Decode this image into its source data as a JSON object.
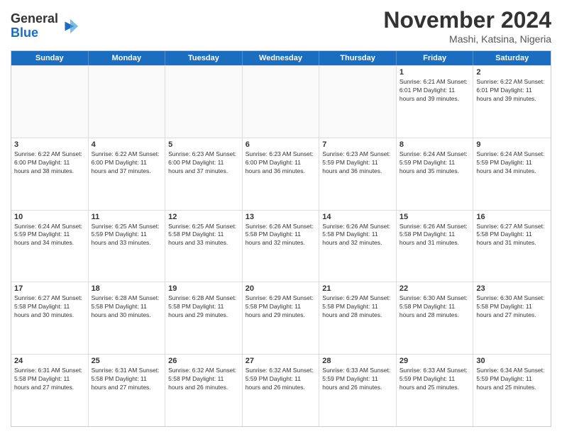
{
  "logo": {
    "general": "General",
    "blue": "Blue"
  },
  "title": "November 2024",
  "location": "Mashi, Katsina, Nigeria",
  "header_days": [
    "Sunday",
    "Monday",
    "Tuesday",
    "Wednesday",
    "Thursday",
    "Friday",
    "Saturday"
  ],
  "weeks": [
    [
      {
        "day": "",
        "info": ""
      },
      {
        "day": "",
        "info": ""
      },
      {
        "day": "",
        "info": ""
      },
      {
        "day": "",
        "info": ""
      },
      {
        "day": "",
        "info": ""
      },
      {
        "day": "1",
        "info": "Sunrise: 6:21 AM\nSunset: 6:01 PM\nDaylight: 11 hours and 39 minutes."
      },
      {
        "day": "2",
        "info": "Sunrise: 6:22 AM\nSunset: 6:01 PM\nDaylight: 11 hours and 39 minutes."
      }
    ],
    [
      {
        "day": "3",
        "info": "Sunrise: 6:22 AM\nSunset: 6:00 PM\nDaylight: 11 hours and 38 minutes."
      },
      {
        "day": "4",
        "info": "Sunrise: 6:22 AM\nSunset: 6:00 PM\nDaylight: 11 hours and 37 minutes."
      },
      {
        "day": "5",
        "info": "Sunrise: 6:23 AM\nSunset: 6:00 PM\nDaylight: 11 hours and 37 minutes."
      },
      {
        "day": "6",
        "info": "Sunrise: 6:23 AM\nSunset: 6:00 PM\nDaylight: 11 hours and 36 minutes."
      },
      {
        "day": "7",
        "info": "Sunrise: 6:23 AM\nSunset: 5:59 PM\nDaylight: 11 hours and 36 minutes."
      },
      {
        "day": "8",
        "info": "Sunrise: 6:24 AM\nSunset: 5:59 PM\nDaylight: 11 hours and 35 minutes."
      },
      {
        "day": "9",
        "info": "Sunrise: 6:24 AM\nSunset: 5:59 PM\nDaylight: 11 hours and 34 minutes."
      }
    ],
    [
      {
        "day": "10",
        "info": "Sunrise: 6:24 AM\nSunset: 5:59 PM\nDaylight: 11 hours and 34 minutes."
      },
      {
        "day": "11",
        "info": "Sunrise: 6:25 AM\nSunset: 5:59 PM\nDaylight: 11 hours and 33 minutes."
      },
      {
        "day": "12",
        "info": "Sunrise: 6:25 AM\nSunset: 5:58 PM\nDaylight: 11 hours and 33 minutes."
      },
      {
        "day": "13",
        "info": "Sunrise: 6:26 AM\nSunset: 5:58 PM\nDaylight: 11 hours and 32 minutes."
      },
      {
        "day": "14",
        "info": "Sunrise: 6:26 AM\nSunset: 5:58 PM\nDaylight: 11 hours and 32 minutes."
      },
      {
        "day": "15",
        "info": "Sunrise: 6:26 AM\nSunset: 5:58 PM\nDaylight: 11 hours and 31 minutes."
      },
      {
        "day": "16",
        "info": "Sunrise: 6:27 AM\nSunset: 5:58 PM\nDaylight: 11 hours and 31 minutes."
      }
    ],
    [
      {
        "day": "17",
        "info": "Sunrise: 6:27 AM\nSunset: 5:58 PM\nDaylight: 11 hours and 30 minutes."
      },
      {
        "day": "18",
        "info": "Sunrise: 6:28 AM\nSunset: 5:58 PM\nDaylight: 11 hours and 30 minutes."
      },
      {
        "day": "19",
        "info": "Sunrise: 6:28 AM\nSunset: 5:58 PM\nDaylight: 11 hours and 29 minutes."
      },
      {
        "day": "20",
        "info": "Sunrise: 6:29 AM\nSunset: 5:58 PM\nDaylight: 11 hours and 29 minutes."
      },
      {
        "day": "21",
        "info": "Sunrise: 6:29 AM\nSunset: 5:58 PM\nDaylight: 11 hours and 28 minutes."
      },
      {
        "day": "22",
        "info": "Sunrise: 6:30 AM\nSunset: 5:58 PM\nDaylight: 11 hours and 28 minutes."
      },
      {
        "day": "23",
        "info": "Sunrise: 6:30 AM\nSunset: 5:58 PM\nDaylight: 11 hours and 27 minutes."
      }
    ],
    [
      {
        "day": "24",
        "info": "Sunrise: 6:31 AM\nSunset: 5:58 PM\nDaylight: 11 hours and 27 minutes."
      },
      {
        "day": "25",
        "info": "Sunrise: 6:31 AM\nSunset: 5:58 PM\nDaylight: 11 hours and 27 minutes."
      },
      {
        "day": "26",
        "info": "Sunrise: 6:32 AM\nSunset: 5:58 PM\nDaylight: 11 hours and 26 minutes."
      },
      {
        "day": "27",
        "info": "Sunrise: 6:32 AM\nSunset: 5:59 PM\nDaylight: 11 hours and 26 minutes."
      },
      {
        "day": "28",
        "info": "Sunrise: 6:33 AM\nSunset: 5:59 PM\nDaylight: 11 hours and 26 minutes."
      },
      {
        "day": "29",
        "info": "Sunrise: 6:33 AM\nSunset: 5:59 PM\nDaylight: 11 hours and 25 minutes."
      },
      {
        "day": "30",
        "info": "Sunrise: 6:34 AM\nSunset: 5:59 PM\nDaylight: 11 hours and 25 minutes."
      }
    ]
  ]
}
